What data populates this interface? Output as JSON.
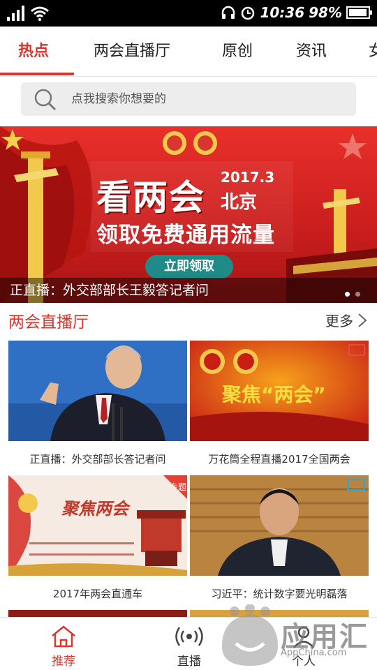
{
  "status_bar": {
    "time": "10:36",
    "battery": "98%"
  },
  "tabs": [
    "热点",
    "两会直播厅",
    "原创",
    "资讯",
    "女"
  ],
  "search": {
    "placeholder": "点我搜索你想要的"
  },
  "banner": {
    "title": "看两会",
    "year": "2017.3",
    "city": "北京",
    "subtitle": "领取免费通用流量",
    "cta": "立即领取",
    "caption": "正直播：外交部部长王毅答记者问"
  },
  "section": {
    "title": "两会直播厅",
    "more": "更多"
  },
  "cards": [
    {
      "caption": "正直播：外交部部长答记者问"
    },
    {
      "caption": "万花筒全程直播2017全国两会",
      "image_text": "聚焦“两会”"
    },
    {
      "caption": "2017年两会直通车",
      "badge": "专题",
      "image_text": "聚焦两会"
    },
    {
      "caption": "习近平：统计数字要光明磊落"
    }
  ],
  "bottom_nav": [
    "推荐",
    "直播",
    "个人"
  ],
  "watermark": {
    "name": "应用汇",
    "domain": "AppChina.com"
  },
  "colors": {
    "accent": "#d9362d",
    "banner_red": "#c91d1d",
    "cta_teal": "#1f8a86"
  }
}
